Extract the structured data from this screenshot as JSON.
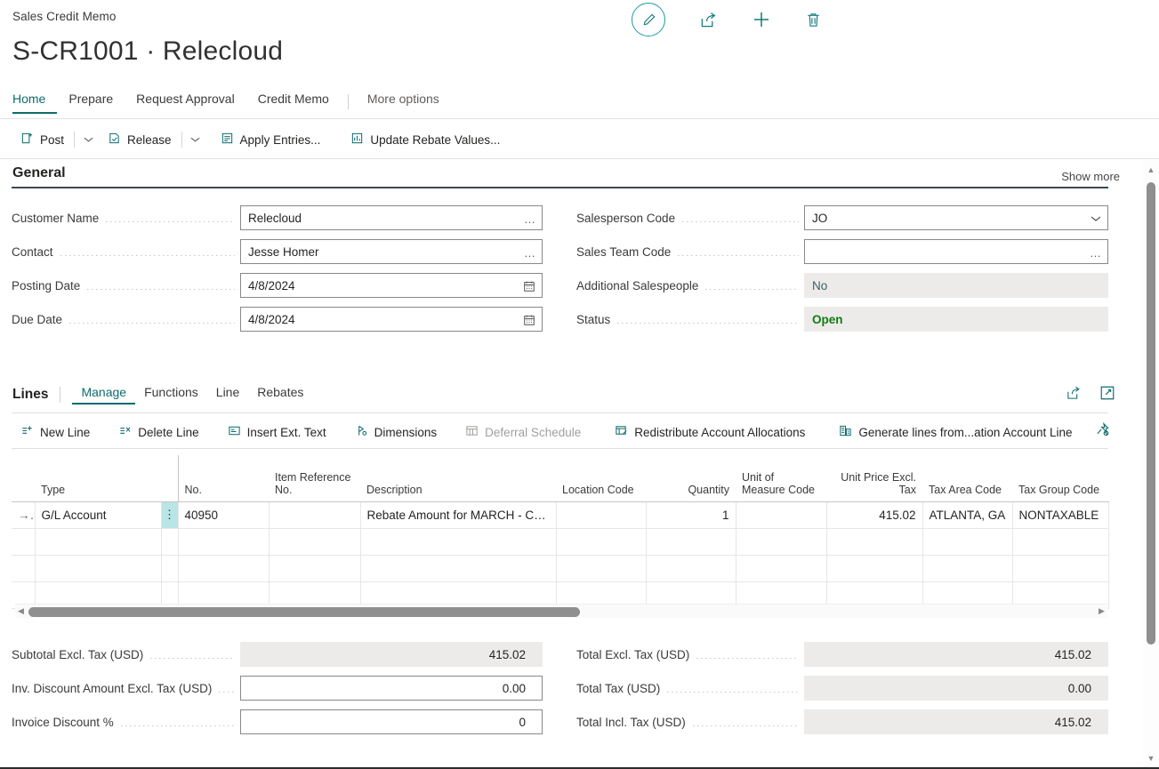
{
  "header": {
    "breadcrumb": "Sales Credit Memo",
    "title": "S-CR1001 · Relecloud",
    "icons": [
      {
        "name": "edit-pencil-icon",
        "label": "Edit"
      },
      {
        "name": "share-icon",
        "label": "Share"
      },
      {
        "name": "plus-new-icon",
        "label": "New"
      },
      {
        "name": "trash-delete-icon",
        "label": "Delete"
      }
    ]
  },
  "tabs": [
    {
      "label": "Home",
      "active": true
    },
    {
      "label": "Prepare",
      "active": false
    },
    {
      "label": "Request Approval",
      "active": false
    },
    {
      "label": "Credit Memo",
      "active": false
    },
    {
      "label": "More options",
      "active": false
    }
  ],
  "toolbar": {
    "post_label": "Post",
    "release_label": "Release",
    "apply_entries_label": "Apply Entries...",
    "update_rebate_label": "Update Rebate Values..."
  },
  "general": {
    "section_title": "General",
    "show_more": "Show more",
    "left_fields": [
      {
        "label": "Customer Name",
        "value": "Relecloud",
        "adorn": "…",
        "style": "box"
      },
      {
        "label": "Contact",
        "value": "Jesse Homer",
        "adorn": "…",
        "style": "box"
      },
      {
        "label": "Posting Date",
        "value": "4/8/2024",
        "adorn": "calendar",
        "style": "box"
      },
      {
        "label": "Due Date",
        "value": "4/8/2024",
        "adorn": "calendar",
        "style": "box"
      }
    ],
    "right_fields": [
      {
        "label": "Salesperson Code",
        "value": "JO",
        "adorn": "chevron",
        "style": "box"
      },
      {
        "label": "Sales Team Code",
        "value": "",
        "adorn": "…",
        "style": "box"
      },
      {
        "label": "Additional Salespeople",
        "value": "No",
        "adorn": "",
        "style": "flat"
      },
      {
        "label": "Status",
        "value": "Open",
        "adorn": "",
        "style": "flat-status"
      }
    ]
  },
  "lines": {
    "title": "Lines",
    "tabs": [
      {
        "label": "Manage",
        "active": true
      },
      {
        "label": "Functions",
        "active": false
      },
      {
        "label": "Line",
        "active": false
      },
      {
        "label": "Rebates",
        "active": false
      }
    ],
    "actions": [
      {
        "label": "New Line",
        "icon": "new-line-icon",
        "disabled": false
      },
      {
        "label": "Delete Line",
        "icon": "delete-line-icon",
        "disabled": false
      },
      {
        "label": "Insert Ext. Text",
        "icon": "insert-text-icon",
        "disabled": false
      },
      {
        "label": "Dimensions",
        "icon": "dimensions-icon",
        "disabled": false
      },
      {
        "label": "Deferral Schedule",
        "icon": "deferral-schedule-icon",
        "disabled": true
      },
      {
        "label": "Redistribute Account Allocations",
        "icon": "redistribute-icon",
        "disabled": false
      },
      {
        "label": "Generate lines from...ation Account Line",
        "icon": "generate-lines-icon",
        "disabled": false
      }
    ],
    "columns": [
      {
        "key": "type",
        "label": "Type",
        "align": "left"
      },
      {
        "key": "no",
        "label": "No.",
        "align": "left"
      },
      {
        "key": "item_ref_no",
        "label": "Item Reference No.",
        "align": "left"
      },
      {
        "key": "description",
        "label": "Description",
        "align": "left"
      },
      {
        "key": "location_code",
        "label": "Location Code",
        "align": "left"
      },
      {
        "key": "quantity",
        "label": "Quantity",
        "align": "right"
      },
      {
        "key": "uom_code",
        "label": "Unit of Measure Code",
        "align": "left"
      },
      {
        "key": "unit_price_excl_tax",
        "label": "Unit Price Excl. Tax",
        "align": "right"
      },
      {
        "key": "tax_area_code",
        "label": "Tax Area Code",
        "align": "left"
      },
      {
        "key": "tax_group_code",
        "label": "Tax Group Code",
        "align": "left"
      }
    ],
    "rows": [
      {
        "selected": true,
        "type": "G/L Account",
        "no": "40950",
        "item_ref_no": "",
        "description": "Rebate Amount for MARCH - CT...",
        "location_code": "",
        "quantity": "1",
        "uom_code": "",
        "unit_price_excl_tax": "415.02",
        "tax_area_code": "ATLANTA, GA",
        "tax_group_code": "NONTAXABLE"
      },
      {
        "selected": false,
        "type": "",
        "no": "",
        "item_ref_no": "",
        "description": "",
        "location_code": "",
        "quantity": "",
        "uom_code": "",
        "unit_price_excl_tax": "",
        "tax_area_code": "",
        "tax_group_code": ""
      },
      {
        "selected": false,
        "type": "",
        "no": "",
        "item_ref_no": "",
        "description": "",
        "location_code": "",
        "quantity": "",
        "uom_code": "",
        "unit_price_excl_tax": "",
        "tax_area_code": "",
        "tax_group_code": ""
      },
      {
        "selected": false,
        "type": "",
        "no": "",
        "item_ref_no": "",
        "description": "",
        "location_code": "",
        "quantity": "",
        "uom_code": "",
        "unit_price_excl_tax": "",
        "tax_area_code": "",
        "tax_group_code": ""
      }
    ]
  },
  "totals": {
    "left_fields": [
      {
        "label": "Subtotal Excl. Tax (USD)",
        "value": "415.02",
        "style": "flat"
      },
      {
        "label": "Inv. Discount Amount Excl. Tax (USD)",
        "value": "0.00",
        "style": "box"
      },
      {
        "label": "Invoice Discount %",
        "value": "0",
        "style": "box"
      }
    ],
    "right_fields": [
      {
        "label": "Total Excl. Tax (USD)",
        "value": "415.02",
        "style": "flat"
      },
      {
        "label": "Total Tax (USD)",
        "value": "0.00",
        "style": "flat"
      },
      {
        "label": "Total Incl. Tax (USD)",
        "value": "415.02",
        "style": "flat"
      }
    ]
  },
  "colors": {
    "accent": "#0f6b6e",
    "icon_teal": "#147a7c",
    "status_green": "#107c10",
    "grid_select": "#b9e5e6"
  }
}
